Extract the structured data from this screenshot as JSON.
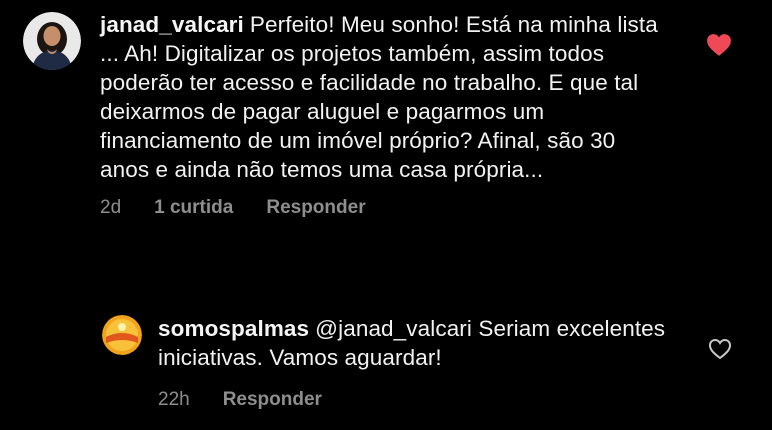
{
  "comments": [
    {
      "username": "janad_valcari",
      "text": "Perfeito! Meu sonho! Está na minha lista ... Ah! Digitalizar os projetos também, assim todos poderão ter acesso e facilidade no trabalho. E que tal deixarmos de pagar aluguel e pagarmos um financiamento de um imóvel próprio? Afinal, são 30 anos e ainda não temos uma casa própria...",
      "time": "2d",
      "likes": "1 curtida",
      "reply_label": "Responder",
      "liked": true,
      "icon": "heart-filled-icon",
      "like_color": "#ed4956"
    },
    {
      "username": "somospalmas",
      "text": "@janad_valcari Seriam excelentes iniciativas. Vamos aguardar!",
      "time": "22h",
      "reply_label": "Responder",
      "liked": false,
      "icon": "heart-outline-icon"
    }
  ],
  "colors": {
    "background": "#000000",
    "text": "#f2f2f2",
    "meta": "#8e8e8e",
    "like": "#ed4956"
  }
}
